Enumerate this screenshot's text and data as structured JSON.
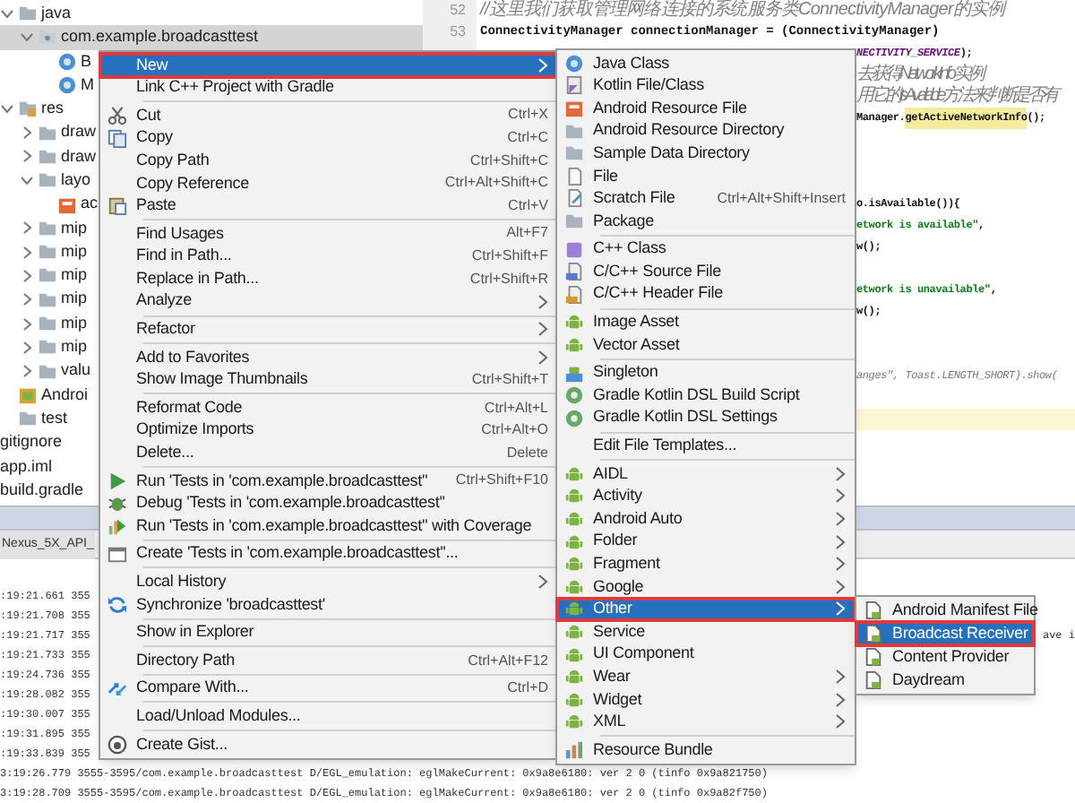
{
  "project_tree": [
    {
      "label": "java",
      "kind": "folder",
      "expanded": true,
      "selected": false,
      "children": [
        {
          "label": "com.example.broadcasttest",
          "kind": "package",
          "expanded": true,
          "selected": true,
          "children": [
            {
              "label": "B",
              "kind": "class",
              "selected": false
            },
            {
              "label": "M",
              "kind": "class",
              "selected": false
            }
          ]
        }
      ]
    },
    {
      "label": "res",
      "kind": "res",
      "expanded": true,
      "selected": false,
      "children": [
        {
          "label": "draw",
          "kind": "folder",
          "expanded": false,
          "selected": false
        },
        {
          "label": "draw",
          "kind": "folder",
          "expanded": false,
          "selected": false
        },
        {
          "label": "layo",
          "kind": "folder",
          "expanded": true,
          "selected": false,
          "children": [
            {
              "label": "ac",
              "kind": "layout",
              "selected": false
            }
          ]
        },
        {
          "label": "mip",
          "kind": "folder",
          "expanded": false,
          "selected": false
        },
        {
          "label": "mip",
          "kind": "folder",
          "expanded": false,
          "selected": false
        },
        {
          "label": "mip",
          "kind": "folder",
          "expanded": false,
          "selected": false
        },
        {
          "label": "mip",
          "kind": "folder",
          "expanded": false,
          "selected": false
        },
        {
          "label": "mip",
          "kind": "folder",
          "expanded": false,
          "selected": false
        },
        {
          "label": "mip",
          "kind": "folder",
          "expanded": false,
          "selected": false
        },
        {
          "label": "valu",
          "kind": "folder",
          "expanded": false,
          "selected": false
        }
      ]
    },
    {
      "label": "Androi",
      "kind": "manifest",
      "selected": false
    },
    {
      "label": "test",
      "kind": "folder",
      "selected": false
    },
    {
      "label": "gitignore",
      "kind": "plain",
      "selected": false
    },
    {
      "label": "app.iml",
      "kind": "plain",
      "selected": false
    },
    {
      "label": "build.gradle",
      "kind": "plain",
      "selected": false
    }
  ],
  "line_numbers": [
    "52",
    "53"
  ],
  "editor": {
    "lines": [
      {
        "kind": "code",
        "segments": [
          {
            "kind": "comment",
            "text": "//这里我们获取管理网络连接的系统服务类ConnectivityManager的实例"
          }
        ]
      },
      {
        "kind": "code",
        "segments": [
          {
            "kind": "plain",
            "text": "ConnectivityManager connectionManager = (ConnectivityManager)"
          }
        ]
      },
      {
        "kind": "code",
        "segments": [
          {
            "kind": "constant",
            "text": "NECTIVITY_SERVICE"
          },
          {
            "kind": "plain",
            "text": ");"
          }
        ]
      },
      {
        "kind": "code",
        "segments": [
          {
            "kind": "comment",
            "text": "去获得NetworkInfo实例"
          }
        ]
      },
      {
        "kind": "code",
        "segments": [
          {
            "kind": "comment",
            "text": "用它的isAvailable方法来判断是否有"
          }
        ]
      },
      {
        "kind": "code",
        "segments": [
          {
            "kind": "plain",
            "text": "Manager."
          },
          {
            "kind": "highlight",
            "text": "getActiveNetworkInfo"
          },
          {
            "kind": "plain",
            "text": "();"
          }
        ]
      },
      {
        "kind": "blank"
      },
      {
        "kind": "blank"
      },
      {
        "kind": "blank"
      },
      {
        "kind": "code",
        "segments": [
          {
            "kind": "plain",
            "text": "o.isAvailable()){"
          }
        ]
      },
      {
        "kind": "code",
        "segments": [
          {
            "kind": "string",
            "text": "etwork is available\""
          },
          {
            "kind": "plain",
            "text": ","
          }
        ]
      },
      {
        "kind": "code",
        "segments": [
          {
            "kind": "plain",
            "text": "w();"
          }
        ]
      },
      {
        "kind": "blank"
      },
      {
        "kind": "code",
        "segments": [
          {
            "kind": "string",
            "text": "etwork is unavailable\""
          },
          {
            "kind": "plain",
            "text": ","
          }
        ]
      },
      {
        "kind": "code",
        "segments": [
          {
            "kind": "plain",
            "text": "w();"
          }
        ]
      },
      {
        "kind": "blank"
      },
      {
        "kind": "blank"
      },
      {
        "kind": "code",
        "segments": [
          {
            "kind": "muted",
            "text": "anges\", Toast.LENGTH_SHORT).show("
          }
        ]
      },
      {
        "kind": "blank"
      },
      {
        "kind": "current"
      }
    ]
  },
  "log_panel": {
    "tab": "Nexus_5X_API_",
    "lines": [
      {
        "text": ":19:21.661 355"
      },
      {
        "text": ":19:21.708 355"
      },
      {
        "text": ":19:21.717 355",
        "tail": "ave i"
      },
      {
        "text": ":19:21.733 355"
      },
      {
        "text": ":19:24.736 355"
      },
      {
        "text": ":19:28.082 355"
      },
      {
        "text": ":19:30.007 355"
      },
      {
        "text": ":19:31.895 355"
      },
      {
        "text": ":19:33.839 355"
      },
      {
        "text": "3:19:26.779 3555-3595/com.example.broadcasttest D/EGL_emulation: eglMakeCurrent: 0x9a8e6180: ver 2 0 (tinfo 0x9a821750)"
      },
      {
        "text": "3:19:28.709 3555-3595/com.example.broadcasttest D/EGL_emulation: eglMakeCurrent: 0x9a8e6180: ver 2 0 (tinfo 0x9a82f750)"
      }
    ]
  },
  "context_menu": {
    "items": [
      {
        "kind": "item",
        "label": "New",
        "submenu": true,
        "selected": true,
        "marked": true
      },
      {
        "kind": "item",
        "label": "Link C++ Project with Gradle",
        "selected": false,
        "marked": false
      },
      {
        "kind": "separator"
      },
      {
        "kind": "item",
        "label": "Cut",
        "shortcut": "Ctrl+X",
        "selected": false,
        "marked": false
      },
      {
        "kind": "item",
        "label": "Copy",
        "shortcut": "Ctrl+C",
        "selected": false,
        "marked": false
      },
      {
        "kind": "item",
        "label": "Copy Path",
        "shortcut": "Ctrl+Shift+C",
        "selected": false,
        "marked": false
      },
      {
        "kind": "item",
        "label": "Copy Reference",
        "shortcut": "Ctrl+Alt+Shift+C",
        "selected": false,
        "marked": false
      },
      {
        "kind": "item",
        "label": "Paste",
        "shortcut": "Ctrl+V",
        "selected": false,
        "marked": false
      },
      {
        "kind": "separator"
      },
      {
        "kind": "item",
        "label": "Find Usages",
        "shortcut": "Alt+F7",
        "selected": false,
        "marked": false
      },
      {
        "kind": "item",
        "label": "Find in Path...",
        "shortcut": "Ctrl+Shift+F",
        "selected": false,
        "marked": false
      },
      {
        "kind": "item",
        "label": "Replace in Path...",
        "shortcut": "Ctrl+Shift+R",
        "selected": false,
        "marked": false
      },
      {
        "kind": "item",
        "label": "Analyze",
        "submenu": true,
        "selected": false,
        "marked": false
      },
      {
        "kind": "separator"
      },
      {
        "kind": "item",
        "label": "Refactor",
        "submenu": true,
        "selected": false,
        "marked": false
      },
      {
        "kind": "separator"
      },
      {
        "kind": "item",
        "label": "Add to Favorites",
        "submenu": true,
        "selected": false,
        "marked": false
      },
      {
        "kind": "item",
        "label": "Show Image Thumbnails",
        "shortcut": "Ctrl+Shift+T",
        "selected": false,
        "marked": false
      },
      {
        "kind": "separator"
      },
      {
        "kind": "item",
        "label": "Reformat Code",
        "shortcut": "Ctrl+Alt+L",
        "selected": false,
        "marked": false
      },
      {
        "kind": "item",
        "label": "Optimize Imports",
        "shortcut": "Ctrl+Alt+O",
        "selected": false,
        "marked": false
      },
      {
        "kind": "item",
        "label": "Delete...",
        "shortcut": "Delete",
        "selected": false,
        "marked": false
      },
      {
        "kind": "separator"
      },
      {
        "kind": "item",
        "label": "Run 'Tests in 'com.example.broadcasttest''",
        "shortcut": "Ctrl+Shift+F10",
        "selected": false,
        "marked": false
      },
      {
        "kind": "item",
        "label": "Debug 'Tests in 'com.example.broadcasttest''",
        "selected": false,
        "marked": false
      },
      {
        "kind": "item",
        "label": "Run 'Tests in 'com.example.broadcasttest'' with Coverage",
        "selected": false,
        "marked": false
      },
      {
        "kind": "separator"
      },
      {
        "kind": "item",
        "label": "Create 'Tests in 'com.example.broadcasttest''...",
        "selected": false,
        "marked": false
      },
      {
        "kind": "separator"
      },
      {
        "kind": "item",
        "label": "Local History",
        "submenu": true,
        "selected": false,
        "marked": false
      },
      {
        "kind": "item",
        "label": "Synchronize 'broadcasttest'",
        "selected": false,
        "marked": false
      },
      {
        "kind": "separator"
      },
      {
        "kind": "item",
        "label": "Show in Explorer",
        "selected": false,
        "marked": false
      },
      {
        "kind": "separator"
      },
      {
        "kind": "item",
        "label": "Directory Path",
        "shortcut": "Ctrl+Alt+F12",
        "selected": false,
        "marked": false
      },
      {
        "kind": "separator"
      },
      {
        "kind": "item",
        "label": "Compare With...",
        "shortcut": "Ctrl+D",
        "selected": false,
        "marked": false
      },
      {
        "kind": "separator"
      },
      {
        "kind": "item",
        "label": "Load/Unload Modules...",
        "selected": false,
        "marked": false
      },
      {
        "kind": "separator"
      },
      {
        "kind": "item",
        "label": "Create Gist...",
        "selected": false,
        "marked": false
      }
    ]
  },
  "new_submenu": {
    "items": [
      {
        "kind": "item",
        "label": "Java Class",
        "selected": false,
        "marked": false
      },
      {
        "kind": "item",
        "label": "Kotlin File/Class",
        "selected": false,
        "marked": false
      },
      {
        "kind": "item",
        "label": "Android Resource File",
        "selected": false,
        "marked": false
      },
      {
        "kind": "item",
        "label": "Android Resource Directory",
        "selected": false,
        "marked": false
      },
      {
        "kind": "item",
        "label": "Sample Data Directory",
        "selected": false,
        "marked": false
      },
      {
        "kind": "item",
        "label": "File",
        "selected": false,
        "marked": false
      },
      {
        "kind": "item",
        "label": "Scratch File",
        "shortcut": "Ctrl+Alt+Shift+Insert",
        "selected": false,
        "marked": false
      },
      {
        "kind": "item",
        "label": "Package",
        "selected": false,
        "marked": false
      },
      {
        "kind": "separator"
      },
      {
        "kind": "item",
        "label": "C++ Class",
        "selected": false,
        "marked": false
      },
      {
        "kind": "item",
        "label": "C/C++ Source File",
        "selected": false,
        "marked": false
      },
      {
        "kind": "item",
        "label": "C/C++ Header File",
        "selected": false,
        "marked": false
      },
      {
        "kind": "separator"
      },
      {
        "kind": "item",
        "label": "Image Asset",
        "selected": false,
        "marked": false
      },
      {
        "kind": "item",
        "label": "Vector Asset",
        "selected": false,
        "marked": false
      },
      {
        "kind": "separator"
      },
      {
        "kind": "item",
        "label": "Singleton",
        "selected": false,
        "marked": false
      },
      {
        "kind": "item",
        "label": "Gradle Kotlin DSL Build Script",
        "selected": false,
        "marked": false
      },
      {
        "kind": "item",
        "label": "Gradle Kotlin DSL Settings",
        "selected": false,
        "marked": false
      },
      {
        "kind": "separator"
      },
      {
        "kind": "item",
        "label": "Edit File Templates...",
        "selected": false,
        "marked": false
      },
      {
        "kind": "separator"
      },
      {
        "kind": "item",
        "label": "AIDL",
        "submenu": true,
        "selected": false,
        "marked": false
      },
      {
        "kind": "item",
        "label": "Activity",
        "submenu": true,
        "selected": false,
        "marked": false
      },
      {
        "kind": "item",
        "label": "Android Auto",
        "submenu": true,
        "selected": false,
        "marked": false
      },
      {
        "kind": "item",
        "label": "Folder",
        "submenu": true,
        "selected": false,
        "marked": false
      },
      {
        "kind": "item",
        "label": "Fragment",
        "submenu": true,
        "selected": false,
        "marked": false
      },
      {
        "kind": "item",
        "label": "Google",
        "submenu": true,
        "selected": false,
        "marked": false
      },
      {
        "kind": "item",
        "label": "Other",
        "submenu": true,
        "selected": true,
        "marked": true
      },
      {
        "kind": "item",
        "label": "Service",
        "selected": false,
        "marked": false
      },
      {
        "kind": "item",
        "label": "UI Component",
        "selected": false,
        "marked": false
      },
      {
        "kind": "item",
        "label": "Wear",
        "submenu": true,
        "selected": false,
        "marked": false
      },
      {
        "kind": "item",
        "label": "Widget",
        "submenu": true,
        "selected": false,
        "marked": false
      },
      {
        "kind": "item",
        "label": "XML",
        "submenu": true,
        "selected": false,
        "marked": false
      },
      {
        "kind": "separator"
      },
      {
        "kind": "item",
        "label": "Resource Bundle",
        "selected": false,
        "marked": false
      }
    ]
  },
  "other_submenu": {
    "items": [
      {
        "kind": "item",
        "label": "Android Manifest File",
        "selected": false,
        "marked": false
      },
      {
        "kind": "item",
        "label": "Broadcast Receiver",
        "selected": true,
        "marked": true
      },
      {
        "kind": "item",
        "label": "Content Provider",
        "selected": false,
        "marked": false
      },
      {
        "kind": "item",
        "label": "Daydream",
        "selected": false,
        "marked": false
      }
    ]
  }
}
